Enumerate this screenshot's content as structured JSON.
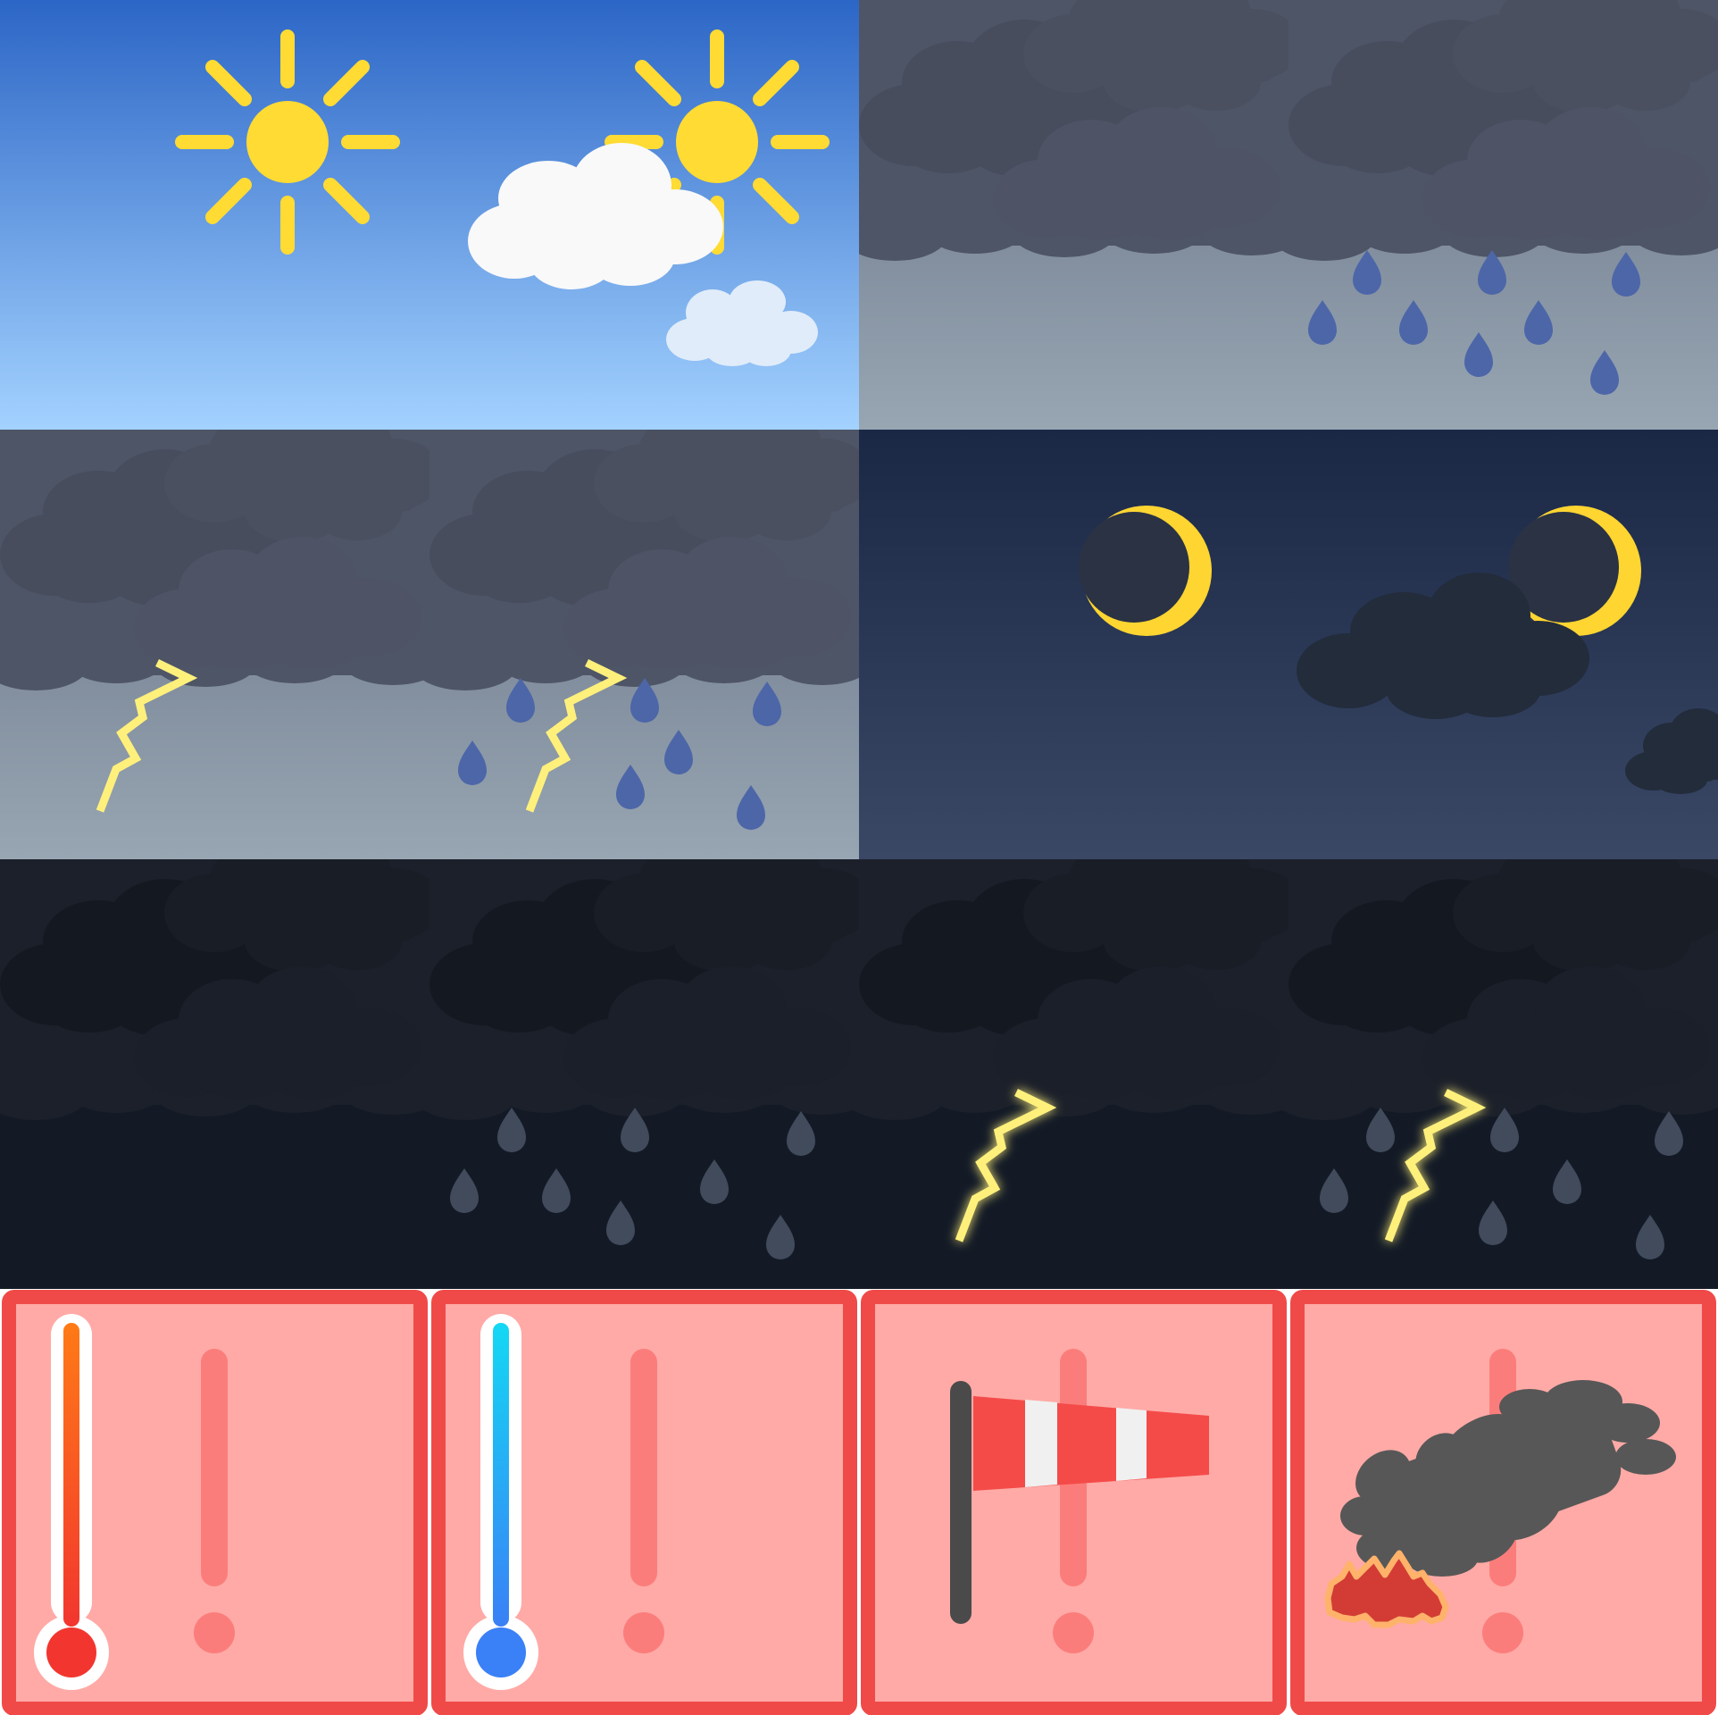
{
  "sheet": {
    "tiles": [
      {
        "name": "clear-day",
        "icons": [
          "sun-icon",
          "sun-behind-cloud-icon"
        ]
      },
      {
        "name": "overcast-rain",
        "icons": [
          "overcast-icon",
          "rain-icon"
        ]
      },
      {
        "name": "thunderstorm",
        "icons": [
          "lightning-icon",
          "thunder-rain-icon"
        ]
      },
      {
        "name": "clear-night",
        "icons": [
          "moon-icon",
          "moon-behind-cloud-icon"
        ]
      },
      {
        "name": "night-storms",
        "icons": [
          "night-overcast-icon",
          "night-rain-icon",
          "night-lightning-icon",
          "night-thunder-rain-icon"
        ]
      },
      {
        "name": "warnings",
        "icons": [
          "heat-warning-icon",
          "cold-warning-icon",
          "wind-warning-icon",
          "wildfire-smoke-warning-icon"
        ]
      }
    ]
  },
  "colors": {
    "sun": "#ffdb33",
    "day_sky_top": "#2c66c6",
    "day_sky_bottom": "#a3d2ff",
    "storm_cloud": "#4b5263",
    "rain_drop": "#4c66a8",
    "night_sky": "#1d2a48",
    "moon": "#ffd531",
    "dark_sky": "#131a26",
    "warning_border": "#f04a48",
    "warning_fill": "#ffaaa6",
    "exclaim": "#fb7d7b",
    "hot": "#f2362f",
    "cold": "#3a80f6",
    "windsock_red": "#f44b49",
    "smoke": "#575757"
  }
}
